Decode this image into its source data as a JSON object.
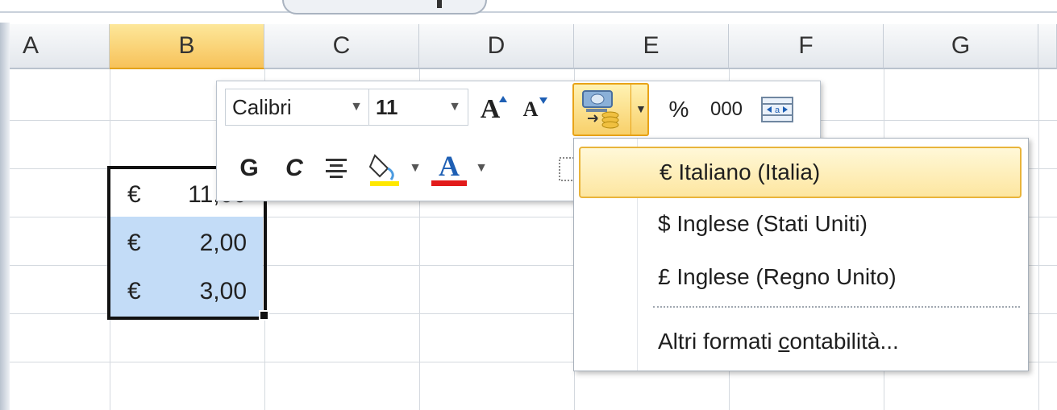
{
  "columns": [
    "A",
    "B",
    "C",
    "D",
    "E",
    "F",
    "G"
  ],
  "selected_column": "B",
  "cells": [
    {
      "symbol": "€",
      "value": "11,00"
    },
    {
      "symbol": "€",
      "value": "2,00"
    },
    {
      "symbol": "€",
      "value": "3,00"
    }
  ],
  "mini_toolbar": {
    "font_name": "Calibri",
    "font_size": "11",
    "grow_font": "A",
    "shrink_font": "A",
    "percent": "%",
    "thousands": "000",
    "bold": "G",
    "italic": "C",
    "font_color_letter": "A"
  },
  "accounting_menu": {
    "items": [
      {
        "label": "€ Italiano (Italia)",
        "highlighted": true
      },
      {
        "label": "$ Inglese (Stati Uniti)"
      },
      {
        "label": "£ Inglese (Regno Unito)"
      }
    ],
    "more_label_prefix": "Altri formati ",
    "more_label_access_key": "c",
    "more_label_suffix": "ontabilità..."
  },
  "colors": {
    "selected_header": "#f7c25a",
    "selection_fill": "#c3dcf7",
    "highlight_yellow": "#ffe800",
    "font_color_red": "#e21b1b"
  }
}
